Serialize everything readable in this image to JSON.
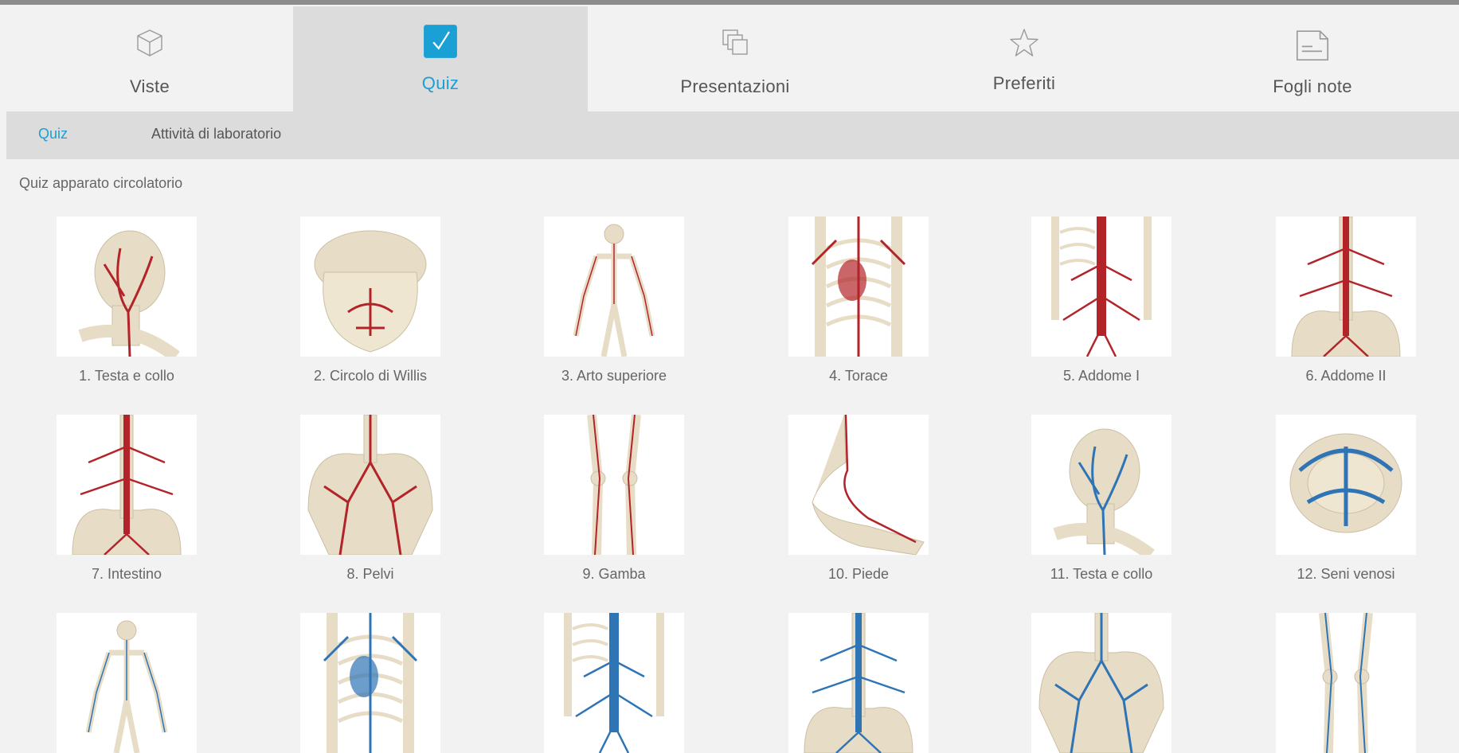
{
  "nav": {
    "tabs": [
      {
        "label": "Viste",
        "icon": "cube-icon"
      },
      {
        "label": "Quiz",
        "icon": "checkbox-icon"
      },
      {
        "label": "Presentazioni",
        "icon": "stacked-pages-icon"
      },
      {
        "label": "Preferiti",
        "icon": "star-icon"
      },
      {
        "label": "Fogli note",
        "icon": "note-sheet-icon"
      }
    ],
    "active_index": 1
  },
  "subnav": {
    "items": [
      "Quiz",
      "Attività di laboratorio"
    ],
    "active_index": 0
  },
  "section_title": "Quiz apparato circolatorio",
  "colors": {
    "accent": "#1aa0d5",
    "artery": "#b3242a",
    "vein": "#2f74b5",
    "bone": "#e7dcc6",
    "tab_active_bg": "#dcdcdc"
  },
  "quizzes": [
    {
      "label": "1. Testa e collo",
      "vessel": "artery",
      "subject": "head-neck"
    },
    {
      "label": "2. Circolo di Willis",
      "vessel": "artery",
      "subject": "skull-base"
    },
    {
      "label": "3. Arto superiore",
      "vessel": "artery",
      "subject": "full-skeleton"
    },
    {
      "label": "4. Torace",
      "vessel": "artery",
      "subject": "thorax"
    },
    {
      "label": "5. Addome I",
      "vessel": "artery",
      "subject": "abdomen"
    },
    {
      "label": "6. Addome II",
      "vessel": "artery",
      "subject": "abdomen-pelvis"
    },
    {
      "label": "7. Intestino",
      "vessel": "artery",
      "subject": "abdomen-pelvis"
    },
    {
      "label": "8. Pelvi",
      "vessel": "artery",
      "subject": "pelvis"
    },
    {
      "label": "9. Gamba",
      "vessel": "artery",
      "subject": "legs"
    },
    {
      "label": "10. Piede",
      "vessel": "artery",
      "subject": "foot"
    },
    {
      "label": "11. Testa e collo",
      "vessel": "vein",
      "subject": "head-neck"
    },
    {
      "label": "12. Seni venosi",
      "vessel": "vein",
      "subject": "skull-sinus"
    },
    {
      "label": "",
      "vessel": "vein",
      "subject": "full-skeleton"
    },
    {
      "label": "",
      "vessel": "vein",
      "subject": "thorax"
    },
    {
      "label": "",
      "vessel": "vein",
      "subject": "abdomen"
    },
    {
      "label": "",
      "vessel": "vein",
      "subject": "abdomen-pelvis"
    },
    {
      "label": "",
      "vessel": "vein",
      "subject": "pelvis"
    },
    {
      "label": "",
      "vessel": "vein",
      "subject": "legs"
    }
  ]
}
